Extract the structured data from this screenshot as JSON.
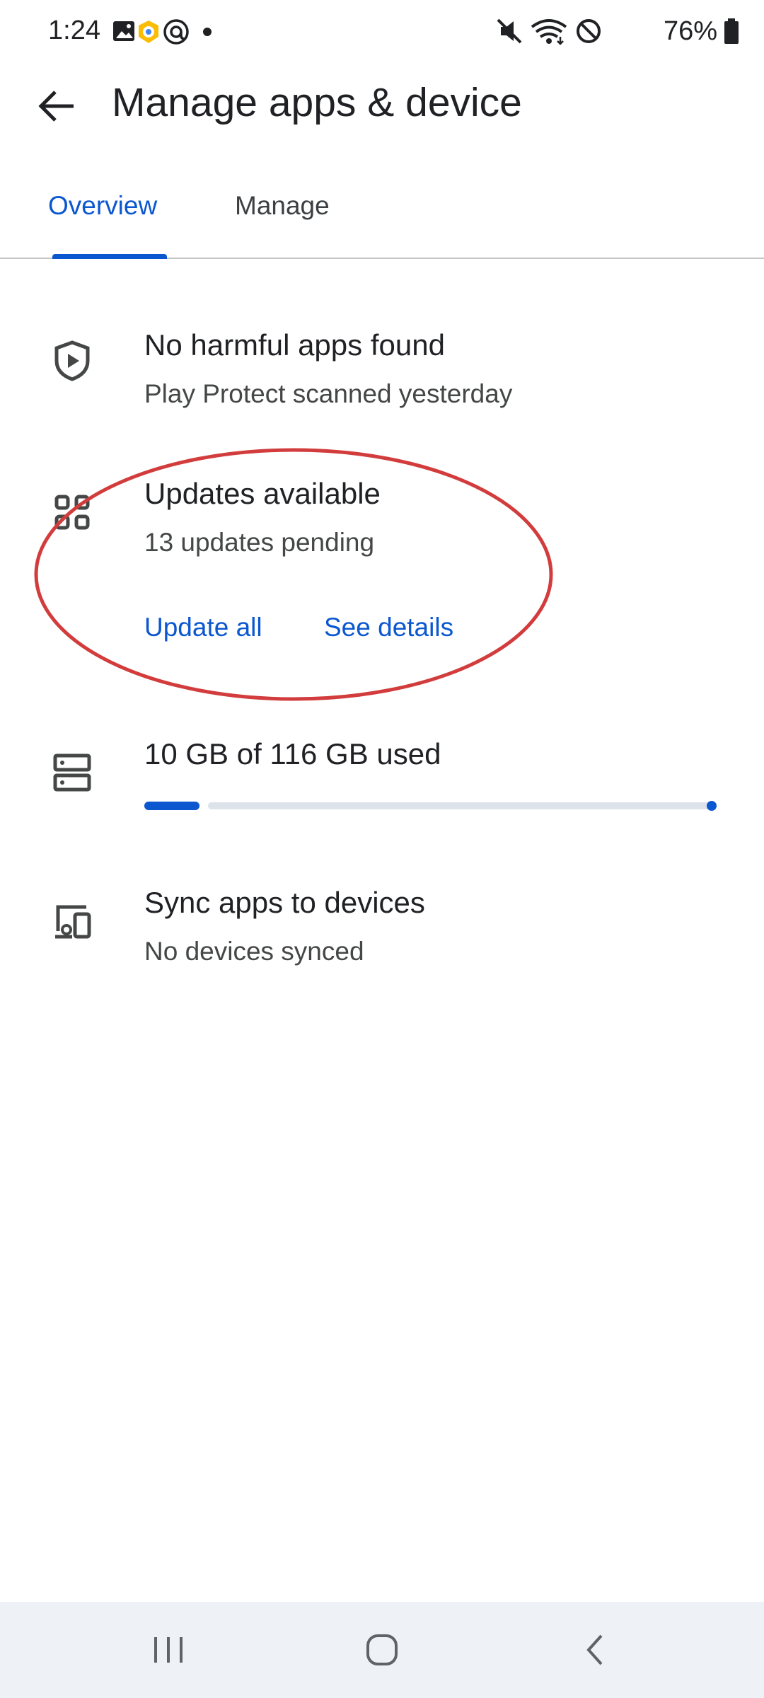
{
  "status_bar": {
    "time": "1:24",
    "battery": "76%",
    "left_icons": [
      "gallery-icon",
      "vpn-icon",
      "at-sign-icon",
      "dot-icon"
    ],
    "right_icons": [
      "mute-icon",
      "wifi-icon",
      "do-not-disturb-icon",
      "battery-icon"
    ]
  },
  "header": {
    "title": "Manage apps & device"
  },
  "tabs": [
    {
      "label": "Overview",
      "selected": true
    },
    {
      "label": "Manage",
      "selected": false
    }
  ],
  "protect": {
    "title": "No harmful apps found",
    "subtitle": "Play Protect scanned yesterday",
    "icon": "shield-play-icon"
  },
  "updates": {
    "title": "Updates available",
    "subtitle": "13 updates pending",
    "icon": "apps-grid-icon",
    "update_all": "Update all",
    "see_details": "See details"
  },
  "storage": {
    "title": "10 GB of 116 GB used",
    "icon": "storage-icon",
    "used_fraction": 0.086
  },
  "sync": {
    "title": "Sync apps to devices",
    "subtitle": "No devices synced",
    "icon": "devices-icon"
  },
  "colors": {
    "accent": "#0b57d0",
    "annotation": "#d23c3c"
  }
}
